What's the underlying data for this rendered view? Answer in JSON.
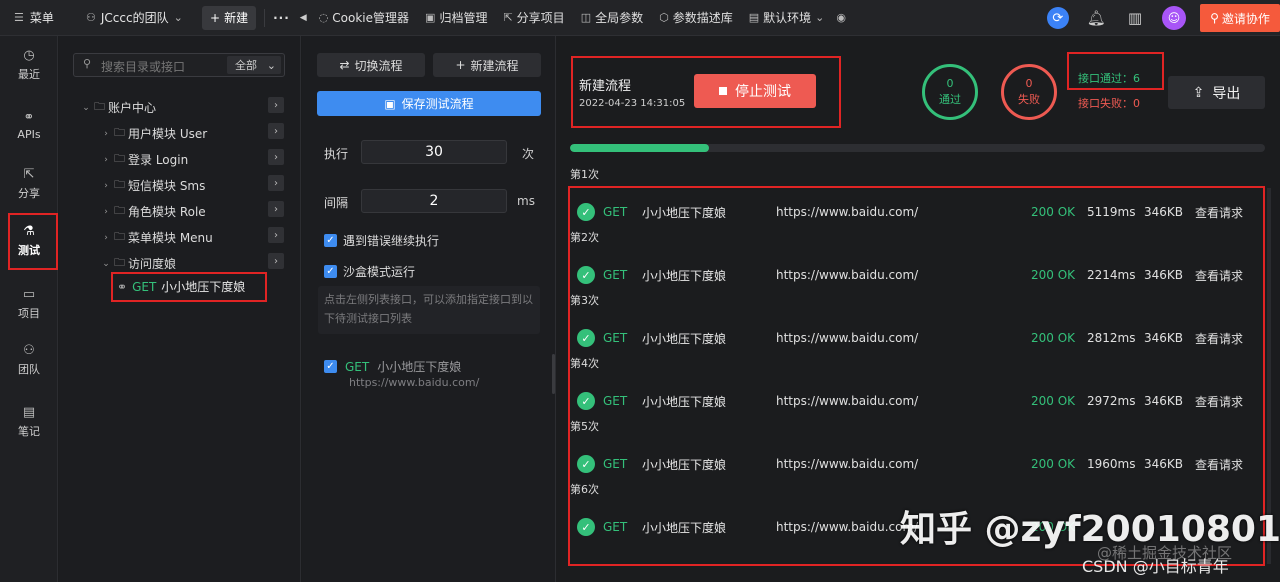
{
  "topbar": {
    "menu_label": "菜单",
    "team_label": "JCccc的团队",
    "new_label": "新建",
    "more": "···",
    "nav": [
      {
        "label": "Cookie管理器",
        "icon": "cookie-icon"
      },
      {
        "label": "归档管理",
        "icon": "archive-icon"
      },
      {
        "label": "分享项目",
        "icon": "share-icon"
      },
      {
        "label": "全局参数",
        "icon": "params-icon"
      },
      {
        "label": "参数描述库",
        "icon": "cube-icon"
      },
      {
        "label": "默认环境",
        "icon": "env-icon"
      }
    ],
    "invite_label": "邀请协作",
    "accent": "#f55a3c"
  },
  "rail": [
    {
      "label": "最近",
      "icon": "clock-icon"
    },
    {
      "label": "APIs",
      "icon": "link-icon"
    },
    {
      "label": "分享",
      "icon": "share-icon"
    },
    {
      "label": "测试",
      "icon": "test-icon"
    },
    {
      "label": "项目",
      "icon": "project-icon"
    },
    {
      "label": "团队",
      "icon": "team-icon"
    },
    {
      "label": "笔记",
      "icon": "note-icon"
    }
  ],
  "tree": {
    "search_placeholder": "搜索目录或接口",
    "filter_value": "全部",
    "root": "账户中心",
    "folders": [
      "用户模块 User",
      "登录 Login",
      "短信模块 Sms",
      "角色模块 Role",
      "菜单模块 Menu",
      "访问度娘"
    ],
    "leaf": {
      "method": "GET",
      "name": "小小地压下度娘"
    }
  },
  "config": {
    "switch_flow": "切换流程",
    "new_flow": "新建流程",
    "save_flow": "保存测试流程",
    "exec_label": "执行",
    "exec_value": "30",
    "exec_unit": "次",
    "interval_label": "间隔",
    "interval_value": "2",
    "interval_unit": "ms",
    "continue_on_error": "遇到错误继续执行",
    "sandbox_mode": "沙盒模式运行",
    "hint": "点击左侧列表接口，可以添加指定接口到以下待测试接口列表",
    "selected": {
      "method": "GET",
      "name": "小小地压下度娘",
      "url": "https://www.baidu.com/"
    }
  },
  "main": {
    "flow_name": "新建流程",
    "flow_time": "2022-04-23 14:31:05",
    "stop_label": "停止测试",
    "pass_count": "0",
    "pass_label": "通过",
    "fail_count": "0",
    "fail_label": "失败",
    "api_pass": "接口通过：6",
    "api_fail": "接口失败：0",
    "export_label": "导出",
    "progress": 0.2,
    "runs": [
      {
        "label": "第1次",
        "method": "GET",
        "name": "小小地压下度娘",
        "url": "https://www.baidu.com/",
        "status": "200 OK",
        "time": "5119ms",
        "size": "346KB",
        "action": "查看请求"
      },
      {
        "label": "第2次",
        "method": "GET",
        "name": "小小地压下度娘",
        "url": "https://www.baidu.com/",
        "status": "200 OK",
        "time": "2214ms",
        "size": "346KB",
        "action": "查看请求"
      },
      {
        "label": "第3次",
        "method": "GET",
        "name": "小小地压下度娘",
        "url": "https://www.baidu.com/",
        "status": "200 OK",
        "time": "2812ms",
        "size": "346KB",
        "action": "查看请求"
      },
      {
        "label": "第4次",
        "method": "GET",
        "name": "小小地压下度娘",
        "url": "https://www.baidu.com/",
        "status": "200 OK",
        "time": "2972ms",
        "size": "346KB",
        "action": "查看请求"
      },
      {
        "label": "第5次",
        "method": "GET",
        "name": "小小地压下度娘",
        "url": "https://www.baidu.com/",
        "status": "200 OK",
        "time": "1960ms",
        "size": "346KB",
        "action": "查看请求"
      },
      {
        "label": "第6次",
        "method": "GET",
        "name": "小小地压下度娘",
        "url": "https://www.baidu.com/",
        "status": "200 OK",
        "time": "",
        "size": "",
        "action": ""
      }
    ],
    "pass_color": "#34c07a",
    "fail_color": "#ee5a52"
  },
  "watermark": {
    "zhihu": "知乎 @zyf20010801",
    "juejin": "@稀土掘金技术社区",
    "csdn": "CSDN @小目标青年"
  }
}
